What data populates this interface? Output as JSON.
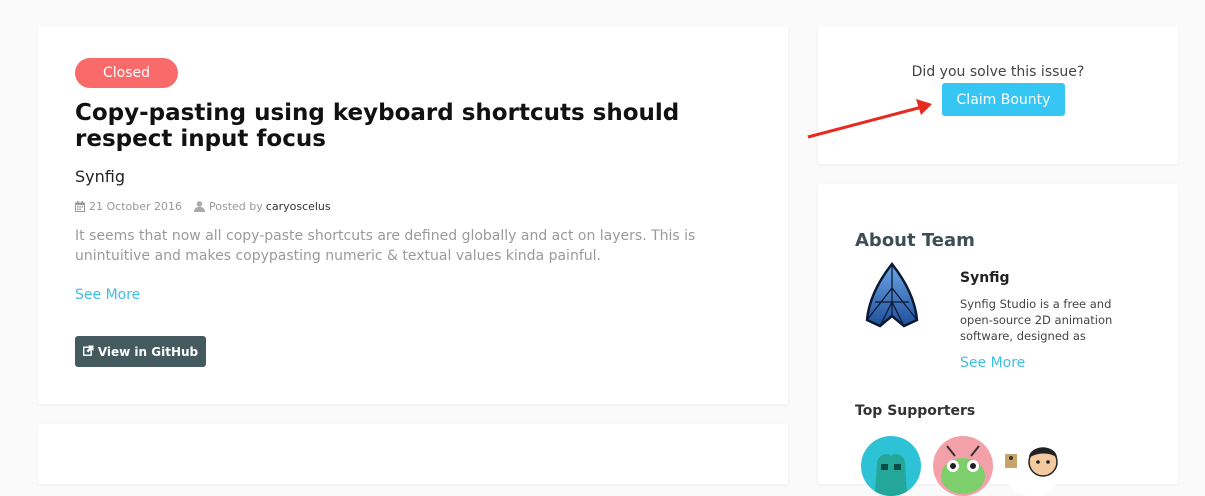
{
  "issue": {
    "status": "Closed",
    "title": "Copy-pasting using keyboard shortcuts should respect input focus",
    "project": "Synfig",
    "date": "21 October 2016",
    "posted_by_label": "Posted by",
    "author": "caryoscelus",
    "description": "It seems that now all copy-paste shortcuts are defined globally and act on layers. This is unintuitive and makes copypasting numeric & textual values kinda painful.",
    "see_more": "See More",
    "github_button": "View in GitHub"
  },
  "bounty": {
    "question": "Did you solve this issue?",
    "claim_button": "Claim Bounty"
  },
  "team": {
    "heading": "About Team",
    "name": "Synfig",
    "description": "Synfig Studio is a free and open-source 2D animation software, designed as",
    "see_more": "See More",
    "supporters_heading": "Top Supporters"
  },
  "colors": {
    "closed_badge": "#f96b6b",
    "accent": "#36c6f4",
    "link": "#3fbfe0",
    "github_button": "#455a5e",
    "annotation_arrow": "#e8291f"
  }
}
